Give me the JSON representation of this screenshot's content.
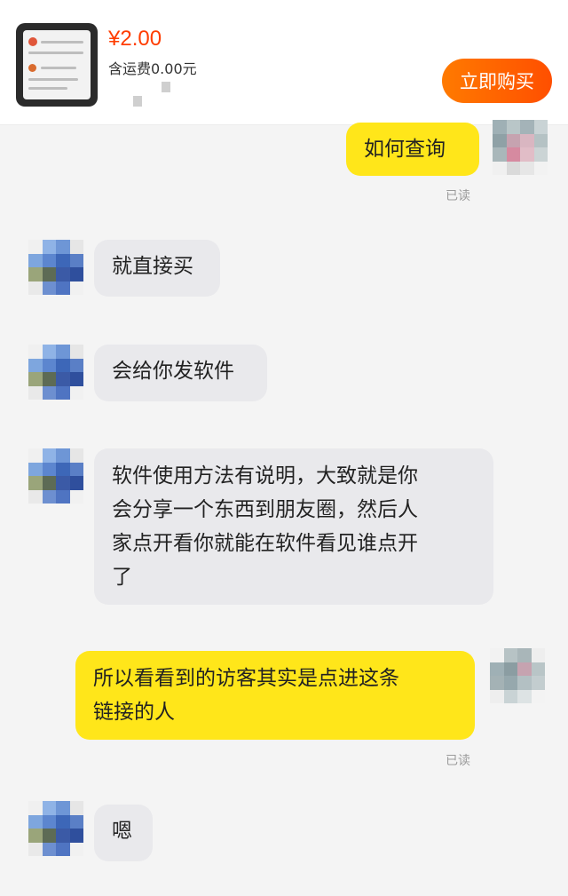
{
  "header": {
    "price": "¥2.00",
    "shipping": "含运费0.00元",
    "buy_label": "立即购买",
    "thumbnail_icon": "product-screenshot-icon"
  },
  "messages": [
    {
      "sender": "me",
      "text": "如何查询",
      "status": "已读"
    },
    {
      "sender": "seller",
      "text": "就直接买"
    },
    {
      "sender": "seller",
      "text": "会给你发软件"
    },
    {
      "sender": "seller",
      "lines": [
        "软件使用方法有说明，大致就是你",
        "会分享一个东西到朋友圈，然后人",
        "家点开看你就能在软件看见谁点开",
        "了"
      ]
    },
    {
      "sender": "me",
      "lines": [
        "所以看看到的访客其实是点进这条",
        "链接的人"
      ],
      "status": "已读"
    },
    {
      "sender": "seller",
      "text": "嗯"
    }
  ],
  "colors": {
    "price": "#ff3d00",
    "buy_button": "#ff5a00",
    "my_bubble": "#ffe61a",
    "seller_bubble": "#e9e9ec",
    "background": "#f4f4f4"
  }
}
